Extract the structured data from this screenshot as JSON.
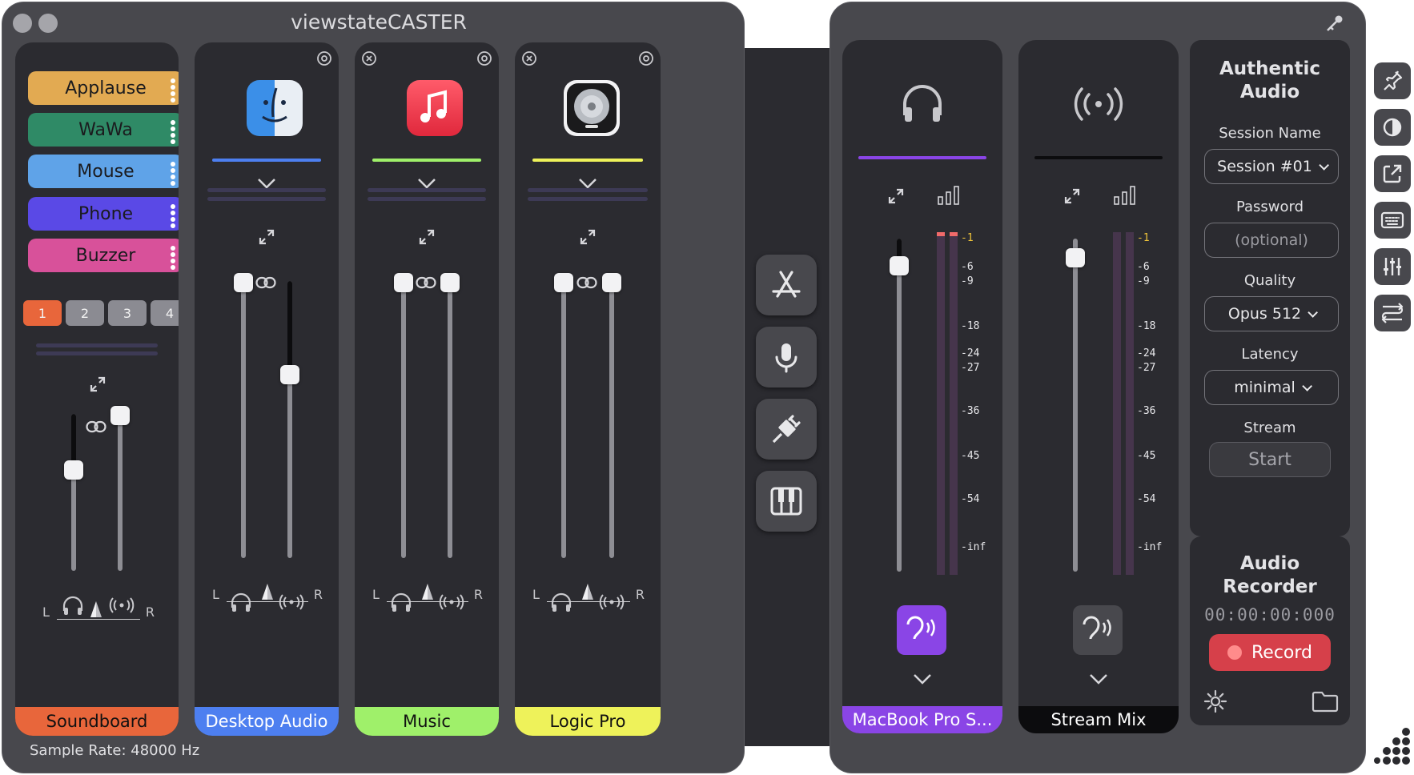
{
  "window": {
    "title": "viewstateCASTER",
    "sample_rate": "Sample Rate: 48000 Hz"
  },
  "soundboard": {
    "name": "Soundboard",
    "buttons": [
      {
        "label": "Applause",
        "color": "#e2aa52"
      },
      {
        "label": "WaWa",
        "color": "#2f8a66"
      },
      {
        "label": "Mouse",
        "color": "#5fa3e8"
      },
      {
        "label": "Phone",
        "color": "#5a49e6"
      },
      {
        "label": "Buzzer",
        "color": "#d8519a"
      }
    ],
    "pages": [
      "1",
      "2",
      "3",
      "4"
    ],
    "active_page": "1",
    "color": "#e8663b"
  },
  "sources": [
    {
      "name": "Desktop Audio",
      "color": "#4d7ff0",
      "icon": "finder-icon"
    },
    {
      "name": "Music",
      "color": "#9ff06a",
      "icon": "music-icon"
    },
    {
      "name": "Logic Pro",
      "color": "#eef25a",
      "icon": "logic-pro-icon"
    }
  ],
  "pan": {
    "left": "L",
    "right": "R"
  },
  "outputs": [
    {
      "name": "MacBook Pro S...",
      "color": "#8a45e6"
    },
    {
      "name": "Stream Mix",
      "color": "#0c0c0e"
    }
  ],
  "db_scale": [
    "-1",
    "-6",
    "-9",
    "-18",
    "-24",
    "-27",
    "-36",
    "-45",
    "-54",
    "-inf"
  ],
  "session": {
    "title": "Authentic Audio",
    "session_name_label": "Session Name",
    "session_name_value": "Session #01",
    "password_label": "Password",
    "password_placeholder": "(optional)",
    "quality_label": "Quality",
    "quality_value": "Opus 512",
    "latency_label": "Latency",
    "latency_value": "minimal",
    "stream_label": "Stream",
    "start_label": "Start"
  },
  "recorder": {
    "title": "Audio Recorder",
    "time": "00:00:00:000",
    "record_label": "Record"
  },
  "colors": {
    "record": "#d6404a",
    "monitor_active": "#8a45e6"
  }
}
